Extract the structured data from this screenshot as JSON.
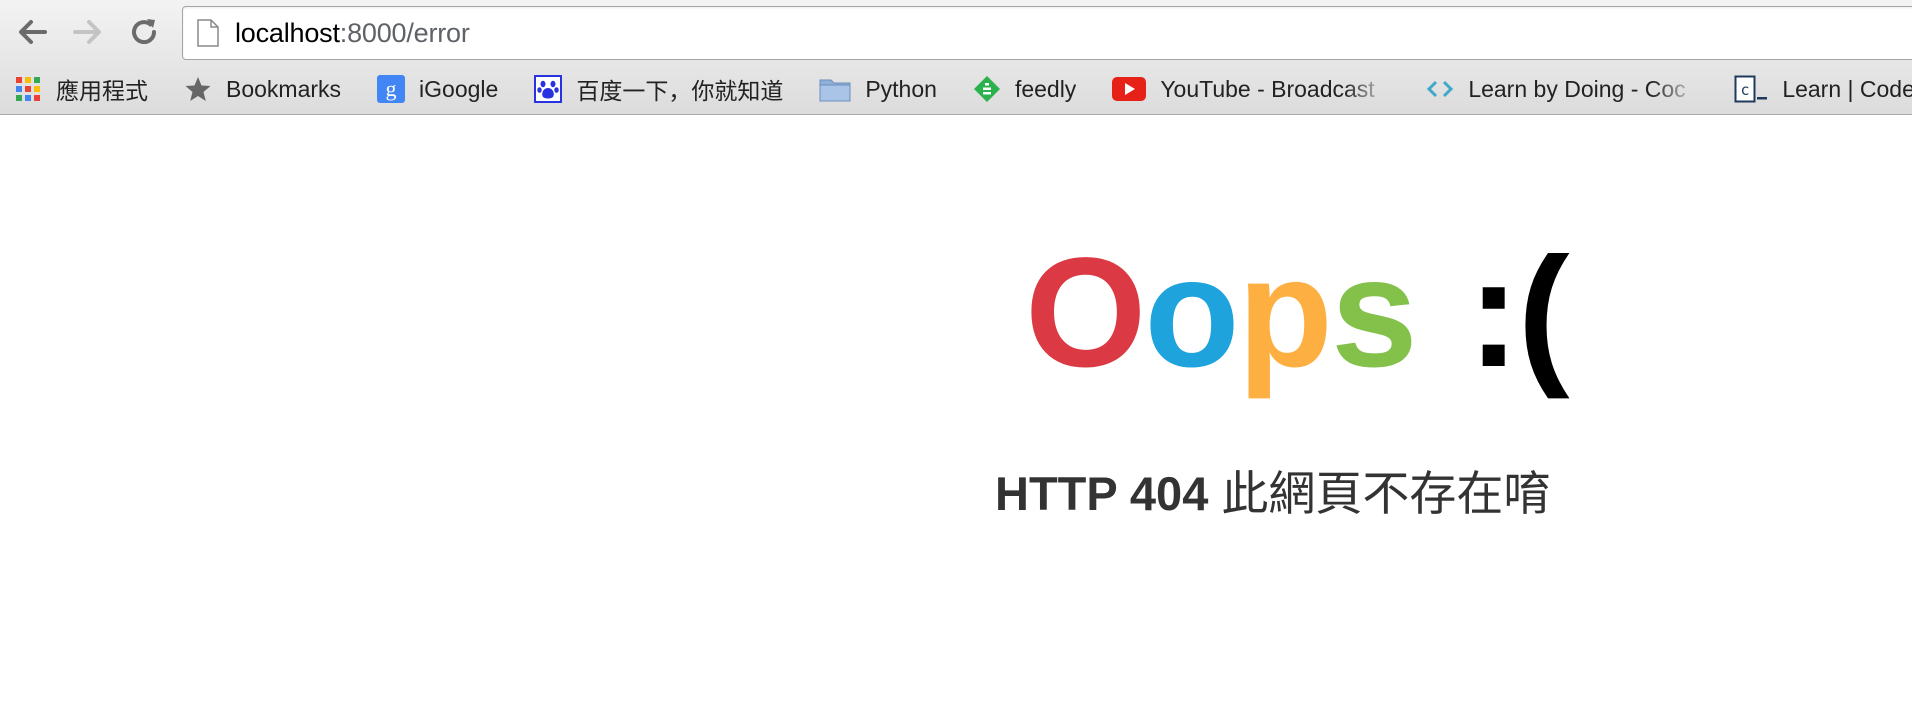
{
  "browser": {
    "url_host": "localhost",
    "url_rest": ":8000/error"
  },
  "bookmarks": [
    {
      "label": "應用程式",
      "icon": "apps-grid-icon"
    },
    {
      "label": "Bookmarks",
      "icon": "star-icon"
    },
    {
      "label": "iGoogle",
      "icon": "google-g-icon"
    },
    {
      "label": "百度一下，你就知道",
      "icon": "baidu-paw-icon"
    },
    {
      "label": "Python",
      "icon": "folder-icon"
    },
    {
      "label": "feedly",
      "icon": "feedly-icon"
    },
    {
      "label": "YouTube - Broadcast",
      "icon": "youtube-icon"
    },
    {
      "label": "Learn by Doing - Coc",
      "icon": "code-brackets-icon"
    },
    {
      "label": "Learn | Codecad",
      "icon": "codecademy-icon"
    }
  ],
  "page": {
    "oops_letters": [
      "O",
      "o",
      "p",
      "s"
    ],
    "sad_face": ":(",
    "subtitle_code": "HTTP 404",
    "subtitle_text": " 此網頁不存在唷"
  },
  "colors": {
    "O": "#db3a45",
    "o": "#1fa3dd",
    "p": "#fdb041",
    "s": "#83c14b"
  }
}
